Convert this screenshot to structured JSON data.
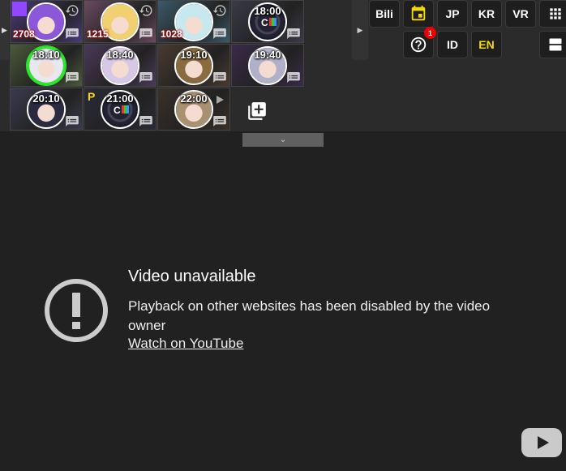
{
  "tiles": [
    {
      "count": "2708",
      "has_twitch": true,
      "has_clock": true,
      "bg": "#4a3a7a",
      "face": "#8a58d8"
    },
    {
      "count": "1215",
      "has_clock": true,
      "bg": "#6a4a60",
      "face": "#f0d070"
    },
    {
      "count": "1028",
      "has_clock": true,
      "bg": "#3a5a6a",
      "face": "#c8e8f0"
    },
    {
      "time": "18:00",
      "logo_avatar": true,
      "bg": "#3a3a4a"
    },
    {
      "time": "18:10",
      "green_ring": true,
      "bg": "#4a5a3a",
      "face": "#e8e8f0"
    },
    {
      "time": "18:40",
      "bg": "#4a3a5a",
      "face": "#d8c8e8"
    },
    {
      "time": "19:10",
      "bg": "#4a3a30",
      "face": "#8a6a40"
    },
    {
      "time": "19:40",
      "bg": "#3a2a4a",
      "face": "#b0b0c8"
    },
    {
      "time": "20:10",
      "bg": "#3a3a50",
      "face": "#2a2a40"
    },
    {
      "time": "21:00",
      "p_badge": "P",
      "logo_avatar": true,
      "bg": "#2a2a38"
    },
    {
      "time": "22:00",
      "has_play": true,
      "bg": "#3a3028",
      "face": "#a89070"
    }
  ],
  "buttons": {
    "bili": "Bili",
    "jp": "JP",
    "kr": "KR",
    "vr": "VR",
    "id": "ID",
    "en": "EN",
    "help_badge": "1"
  },
  "colors": {
    "active_lang": "#f5d90a",
    "calendar": "#f5d90a",
    "badge": "#e00000"
  },
  "video": {
    "title": "Video unavailable",
    "message": "Playback on other websites has been disabled by the video owner",
    "link": "Watch on YouTube"
  }
}
